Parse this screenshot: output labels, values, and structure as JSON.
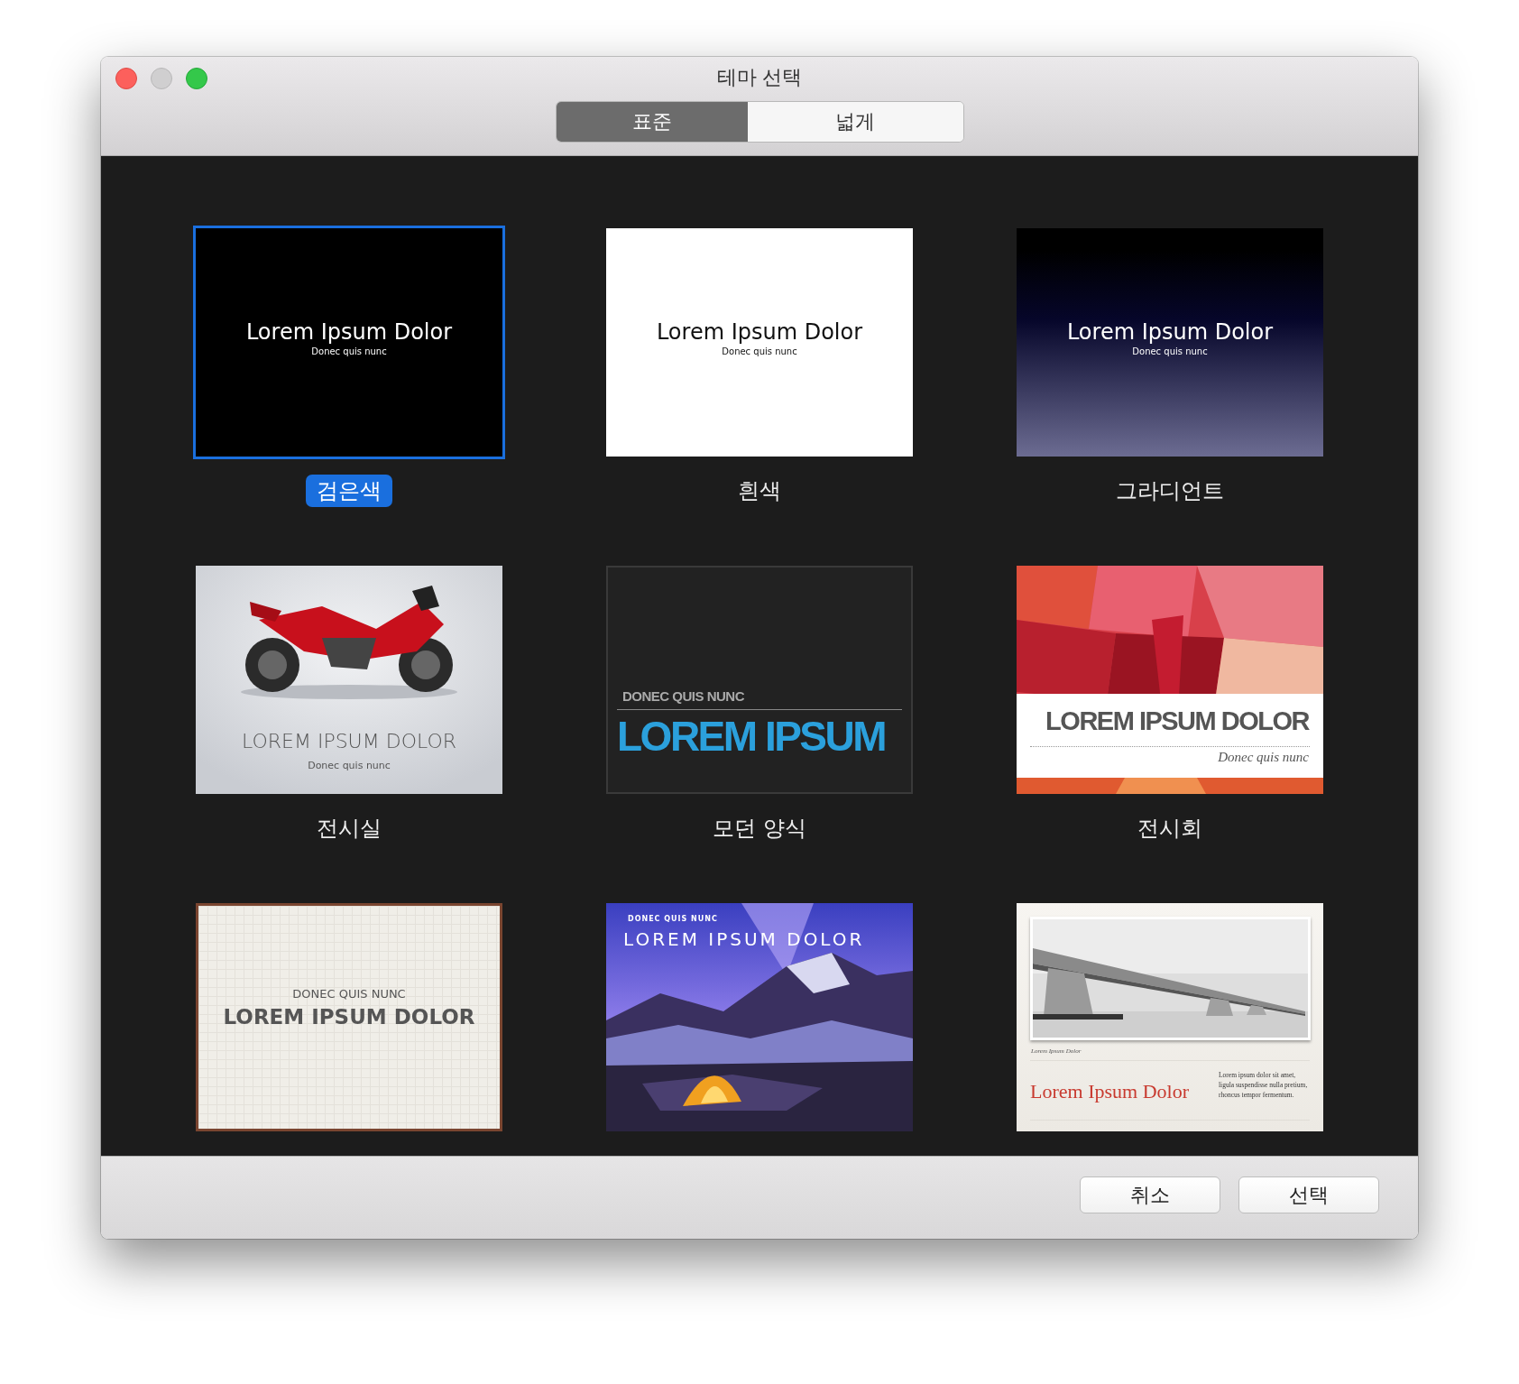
{
  "window": {
    "title": "테마 선택"
  },
  "tabs": [
    {
      "label": "표준",
      "selected": true
    },
    {
      "label": "넓게",
      "selected": false
    }
  ],
  "themes": [
    {
      "kind": "black",
      "name": "검은색",
      "selected": true,
      "slide": {
        "title": "Lorem Ipsum Dolor",
        "subtitle": "Donec quis nunc"
      }
    },
    {
      "kind": "white",
      "name": "흰색",
      "selected": false,
      "slide": {
        "title": "Lorem Ipsum Dolor",
        "subtitle": "Donec quis nunc"
      }
    },
    {
      "kind": "gradient",
      "name": "그라디언트",
      "selected": false,
      "slide": {
        "title": "Lorem Ipsum Dolor",
        "subtitle": "Donec quis nunc"
      }
    },
    {
      "kind": "showroom",
      "name": "전시실",
      "selected": false,
      "slide": {
        "title": "LOREM IPSUM DOLOR",
        "subtitle": "Donec quis nunc"
      }
    },
    {
      "kind": "modern",
      "name": "모던 양식",
      "selected": false,
      "slide": {
        "title": "LOREM IPSUM",
        "subtitle": "DONEC QUIS NUNC"
      }
    },
    {
      "kind": "exhibition",
      "name": "전시회",
      "selected": false,
      "slide": {
        "title": "LOREM IPSUM DOLOR",
        "subtitle": "Donec quis nunc"
      }
    },
    {
      "kind": "paper",
      "selected": false,
      "slide": {
        "title": "LOREM IPSUM DOLOR",
        "subtitle": "DONEC QUIS NUNC"
      }
    },
    {
      "kind": "mountain",
      "selected": false,
      "slide": {
        "title": "LOREM IPSUM DOLOR",
        "subtitle": "DONEC QUIS NUNC"
      }
    },
    {
      "kind": "bridge",
      "selected": false,
      "slide": {
        "title": "Lorem Ipsum Dolor",
        "caption": "Lorem Ipsum Dolor",
        "body": "Lorem ipsum dolor sit amet, ligula suspendisse nulla pretium, rhoncus tempor fermentum."
      }
    }
  ],
  "buttons": [
    {
      "label": "취소"
    },
    {
      "label": "선택"
    }
  ]
}
